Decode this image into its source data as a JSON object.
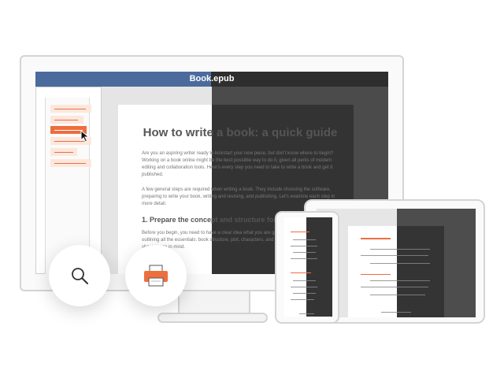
{
  "window": {
    "title": "Book.epub"
  },
  "sidebar": {
    "items": [
      {
        "state": "normal"
      },
      {
        "state": "normal"
      },
      {
        "state": "active"
      },
      {
        "state": "normal"
      },
      {
        "state": "normal"
      },
      {
        "state": "normal"
      }
    ]
  },
  "article": {
    "title": "How to write a book: a quick guide",
    "intro": "Are you an aspiring writer ready to kickstart your new piece, but don't know where to begin? Working on a book online might be the best possible way to do it, given all perks of modern editing and collaboration tools. Here's every step you need to take to write a book and get it published.",
    "overview": "A few general steps are required when writing a book. They include choosing the software, preparing to write your book, writing and revising, and publishing. Let's examine each step in more detail.",
    "heading": "1. Prepare the concept and structure for your book",
    "body": "Before you begin, you need to have a clear idea what you are going to write about. Start by outlining all the essentials: book structure, plot, characters, and setting. Here's what you should keep in mind."
  },
  "actions": {
    "search_icon": "search-icon",
    "print_icon": "printer-icon"
  },
  "colors": {
    "accent": "#ee6e3e",
    "titlebar": "#4a6b9c",
    "dark_mode": "#333333"
  }
}
